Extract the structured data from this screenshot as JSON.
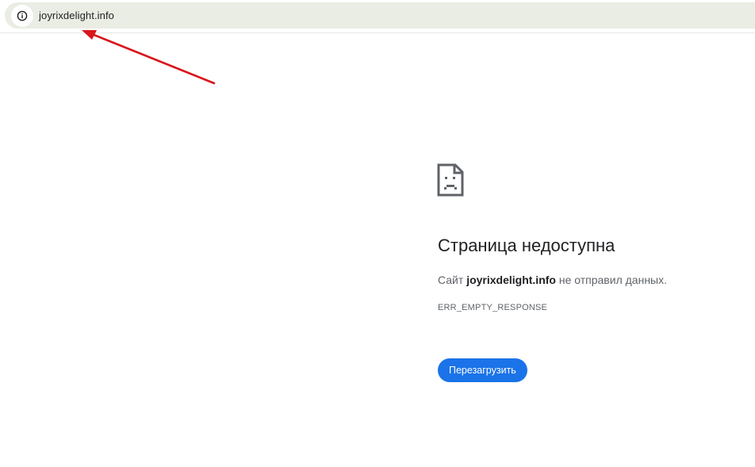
{
  "address_bar": {
    "url": "joyrixdelight.info",
    "site_info_icon": "info-circle-icon"
  },
  "error": {
    "icon": "sad-page-icon",
    "title": "Страница недоступна",
    "description_prefix": "Сайт ",
    "domain": "joyrixdelight.info",
    "description_suffix": " не отправил данных.",
    "code": "ERR_EMPTY_RESPONSE",
    "reload_label": "Перезагрузить"
  },
  "annotation": {
    "icon": "red-arrow-icon",
    "color": "#d9161b"
  },
  "colors": {
    "omnibox_bg": "#e9ede3",
    "button_blue": "#1a73e8",
    "title_text": "#202124",
    "secondary_text": "#5f6368"
  }
}
